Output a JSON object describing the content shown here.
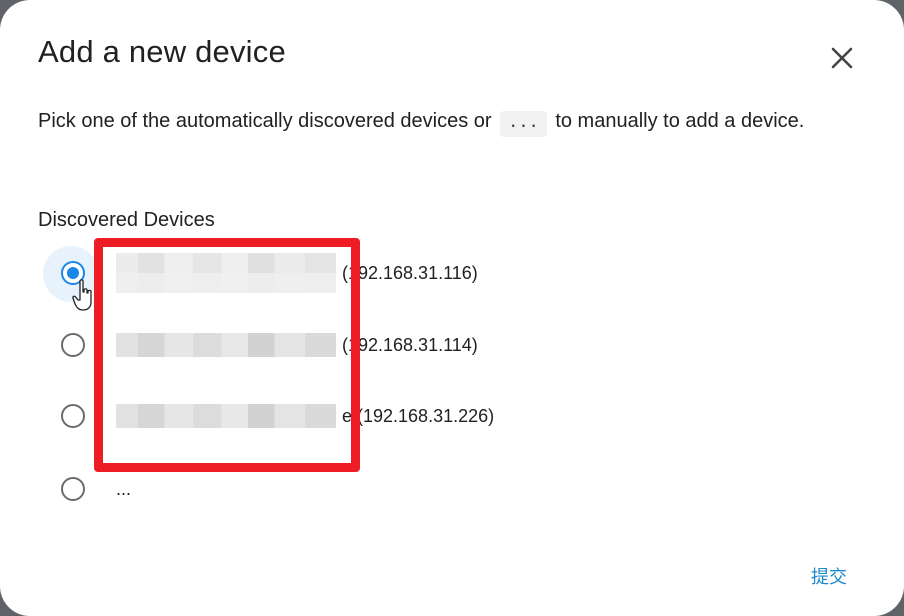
{
  "dialog": {
    "title": "Add a new device",
    "description_before": "Pick one of the automatically discovered devices or",
    "description_code": "...",
    "description_after": "to manually to add a device.",
    "section_label": "Discovered Devices",
    "options": [
      {
        "suffix": "(192.168.31.116)",
        "checked": true
      },
      {
        "suffix": "(192.168.31.114)",
        "checked": false
      },
      {
        "suffix": "e (192.168.31.226)",
        "checked": false
      },
      {
        "label": "...",
        "checked": false
      }
    ],
    "submit_label": "提交"
  },
  "icons": {
    "close": "close-icon",
    "cursor": "hand-cursor-icon"
  },
  "colors": {
    "accent": "#1a88e8",
    "annotation": "#ee1c25",
    "submit_text": "#1a88c9"
  }
}
